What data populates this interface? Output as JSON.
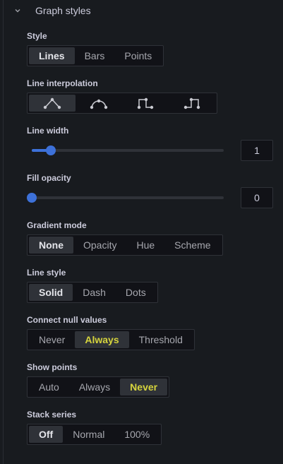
{
  "section": {
    "title": "Graph styles"
  },
  "style": {
    "label": "Style",
    "options": [
      "Lines",
      "Bars",
      "Points"
    ],
    "selected": "Lines"
  },
  "line_interpolation": {
    "label": "Line interpolation",
    "options": [
      "linear-interpolation-icon",
      "smooth-interpolation-icon",
      "step-before-icon",
      "step-after-icon"
    ],
    "selected": "linear-interpolation-icon"
  },
  "line_width": {
    "label": "Line width",
    "value": "1",
    "fraction": 0.1
  },
  "fill_opacity": {
    "label": "Fill opacity",
    "value": "0",
    "fraction": 0
  },
  "gradient_mode": {
    "label": "Gradient mode",
    "options": [
      "None",
      "Opacity",
      "Hue",
      "Scheme"
    ],
    "selected": "None"
  },
  "line_style": {
    "label": "Line style",
    "options": [
      "Solid",
      "Dash",
      "Dots"
    ],
    "selected": "Solid"
  },
  "connect_null": {
    "label": "Connect null values",
    "options": [
      "Never",
      "Always",
      "Threshold"
    ],
    "selected": "Always"
  },
  "show_points": {
    "label": "Show points",
    "options": [
      "Auto",
      "Always",
      "Never"
    ],
    "selected": "Never"
  },
  "stack_series": {
    "label": "Stack series",
    "options": [
      "Off",
      "Normal",
      "100%"
    ],
    "selected": "Off"
  },
  "colors": {
    "accent_blue": "#3d71d9",
    "highlight_yellow": "#d6d43d"
  }
}
